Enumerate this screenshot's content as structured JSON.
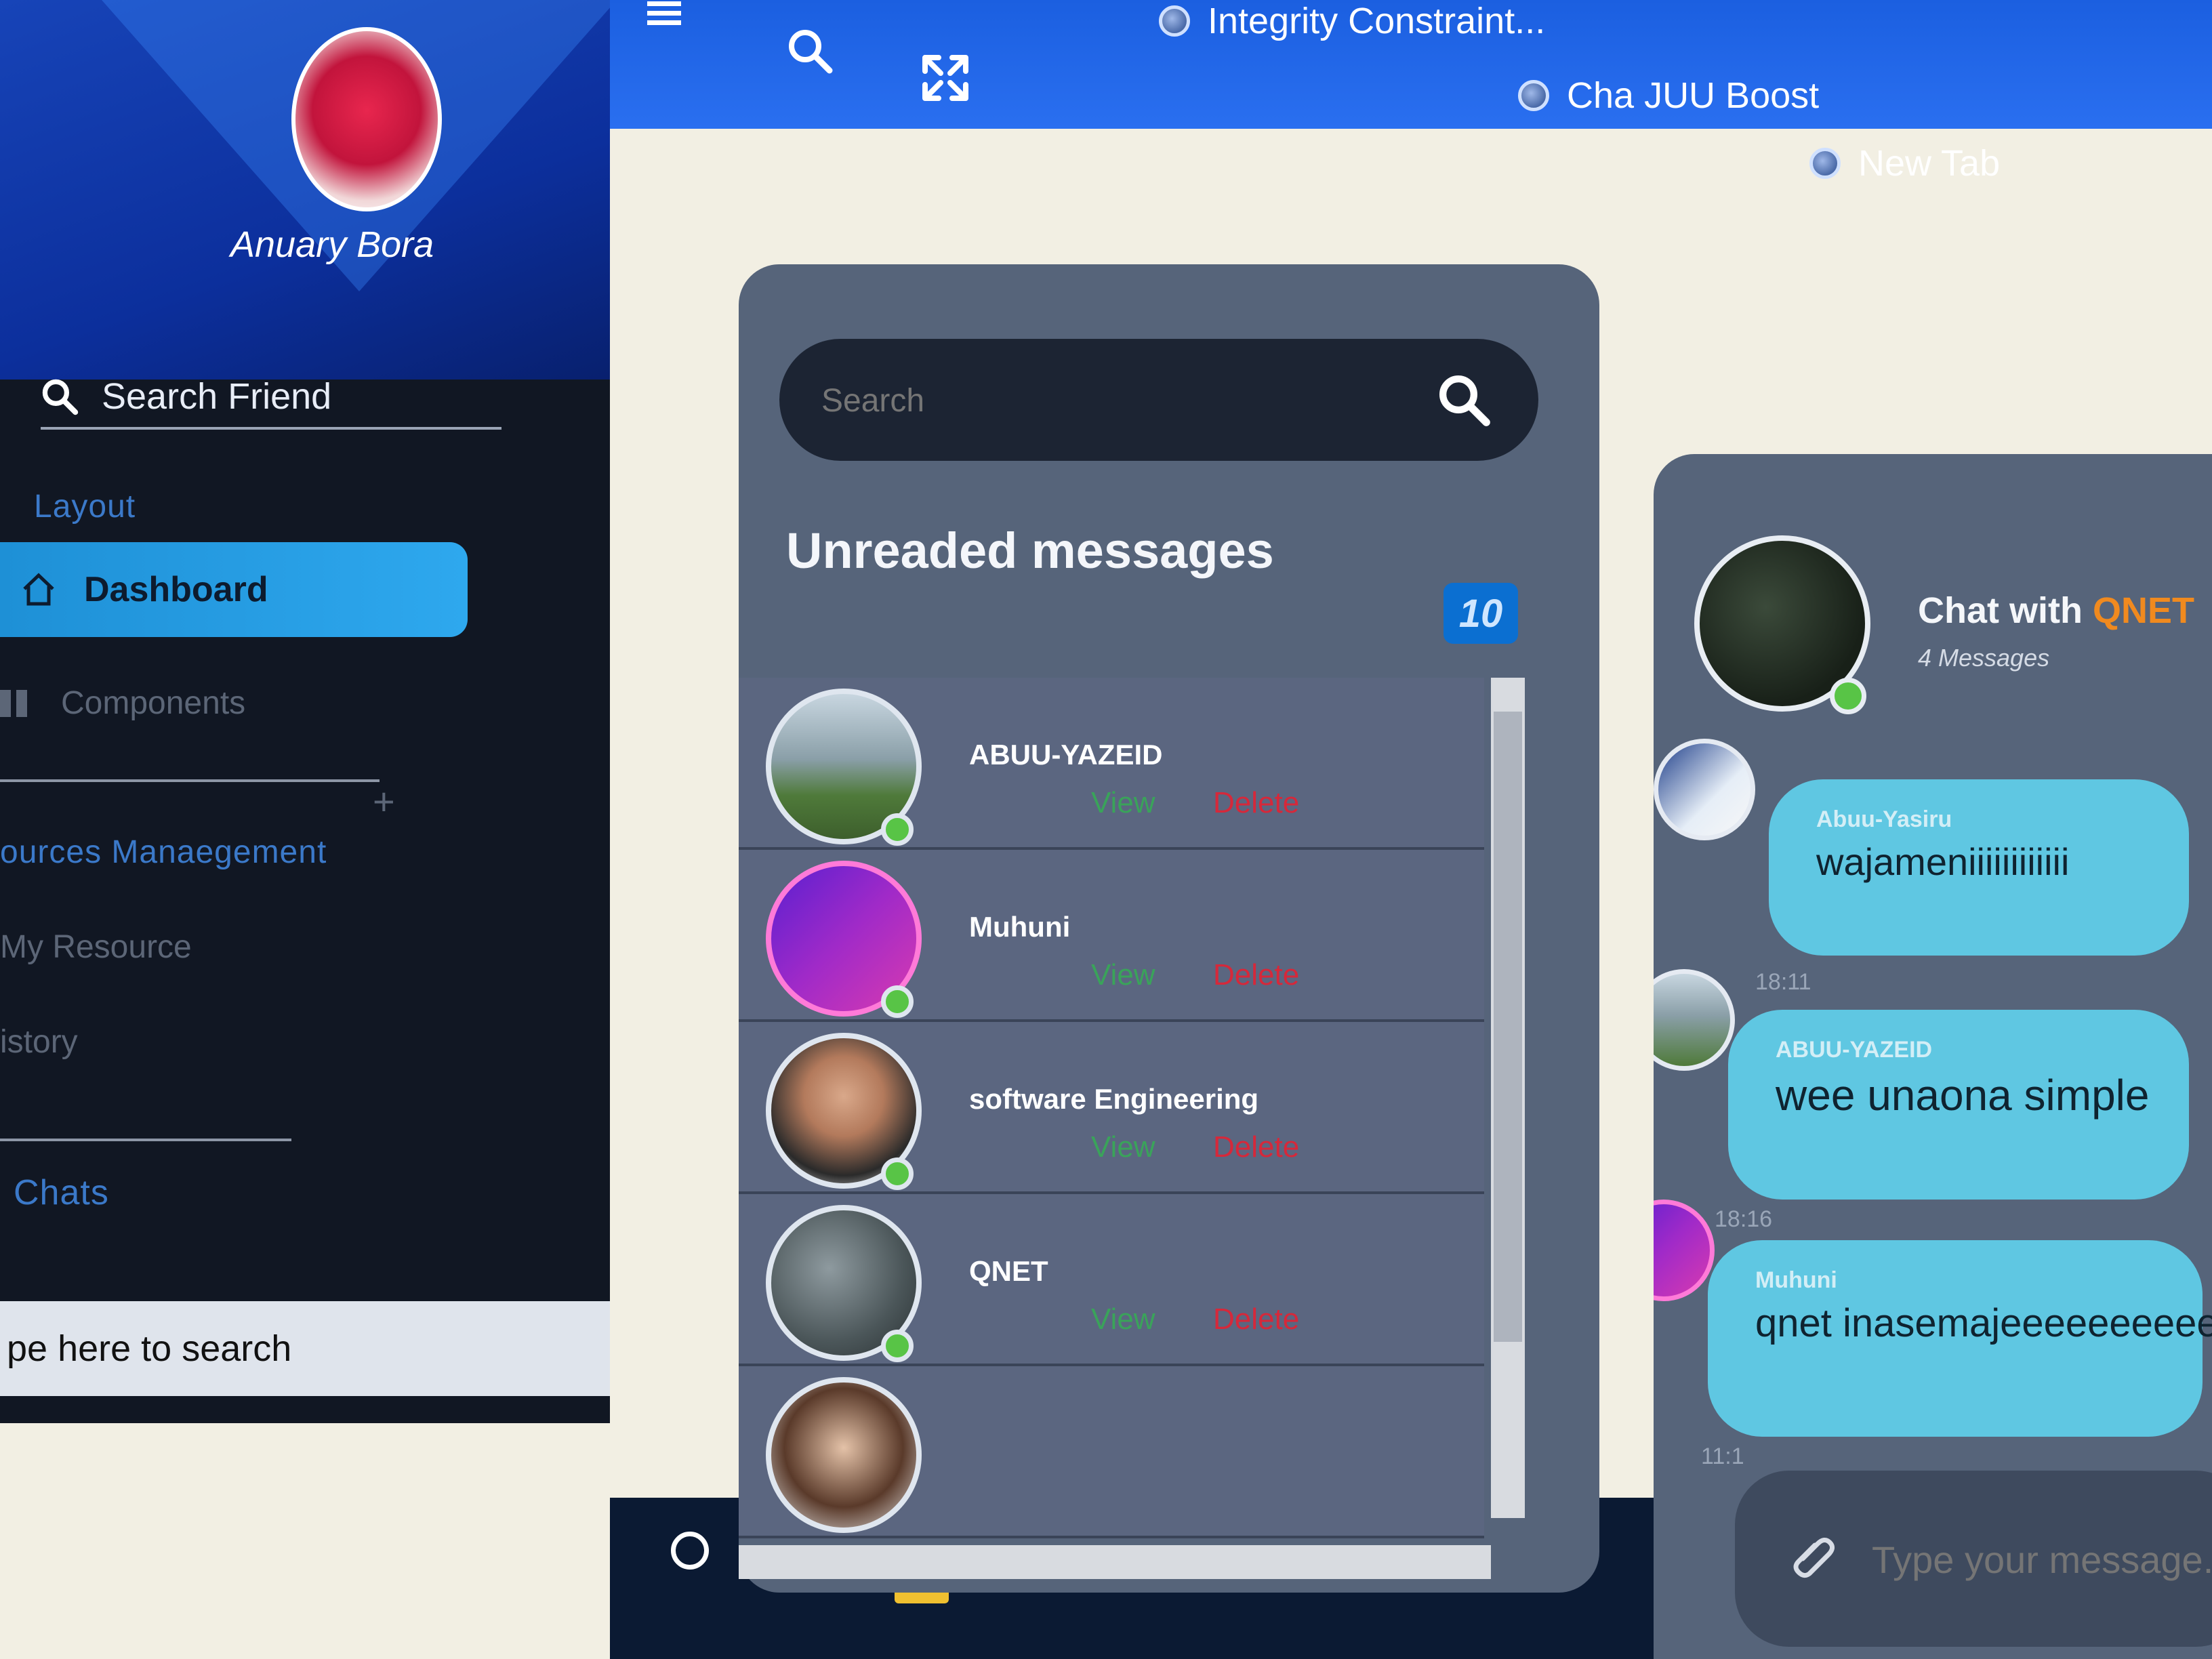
{
  "browser": {
    "tabs": [
      {
        "label": "Integrity Constraint..."
      },
      {
        "label": "Cha JUU Boost"
      },
      {
        "label": "New Tab"
      }
    ],
    "colors": {
      "topbar": "#2a6ff0"
    }
  },
  "sidebar": {
    "username": "Anuary Bora",
    "search_label": "Search Friend",
    "section_layout": "Layout",
    "nav_dashboard": "Dashboard",
    "nav_components": "Components",
    "section_resources": "ources Manaegement",
    "nav_my_resource": "My Resource",
    "nav_history": "istory",
    "section_chats": "Chats",
    "plus_icon": "+",
    "accent": "#2ea8ee"
  },
  "os": {
    "search_placeholder": "pe here to search"
  },
  "unread": {
    "search_placeholder": "Search",
    "title": "Unreaded messages",
    "count": "10",
    "view_label": "View",
    "delete_label": "Delete",
    "contacts": [
      {
        "name": "ABUU-YAZEID"
      },
      {
        "name": "Muhuni"
      },
      {
        "name": "software Engineering"
      },
      {
        "name": "QNET"
      }
    ]
  },
  "chat": {
    "title_prefix": "Chat with",
    "title_name": "QNET",
    "message_count": "4 Messages",
    "messages": [
      {
        "sender": "Abuu-Yasiru",
        "text": "wajameniiiiiiiiiiii",
        "time": "18:11"
      },
      {
        "sender": "ABUU-YAZEID",
        "text": "wee unaona simple",
        "time": "18:16"
      },
      {
        "sender": "Muhuni",
        "text": "qnet inasemajeeeeeeeeee",
        "time": "11:1"
      }
    ],
    "composer_placeholder": "Type your message...",
    "bubble_color": "#5fc7e2",
    "highlight_color": "#f08a1f"
  }
}
